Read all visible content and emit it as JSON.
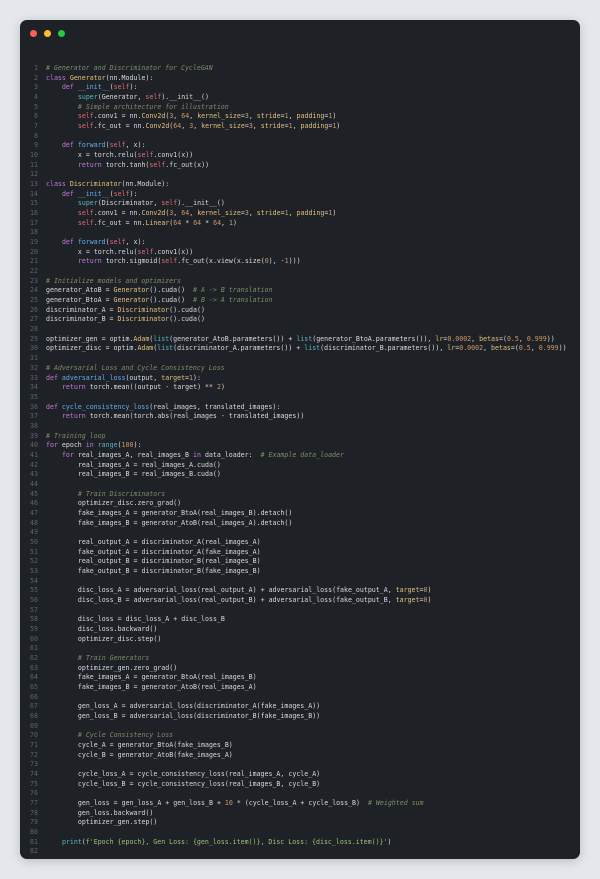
{
  "window": {
    "controls": [
      "close",
      "minimize",
      "maximize"
    ],
    "colors": {
      "close": "#ff5f57",
      "minimize": "#febc2e",
      "maximize": "#28c840",
      "background": "#1e2126"
    }
  },
  "editor": {
    "language": "python",
    "lines": [
      "# Generator and Discriminator for CycleGAN",
      "class Generator(nn.Module):",
      "    def __init__(self):",
      "        super(Generator, self).__init__()",
      "        # Simple architecture for illustration",
      "        self.conv1 = nn.Conv2d(3, 64, kernel_size=3, stride=1, padding=1)",
      "        self.fc_out = nn.Conv2d(64, 3, kernel_size=3, stride=1, padding=1)",
      "",
      "    def forward(self, x):",
      "        x = torch.relu(self.conv1(x))",
      "        return torch.tanh(self.fc_out(x))",
      "",
      "class Discriminator(nn.Module):",
      "    def __init__(self):",
      "        super(Discriminator, self).__init__()",
      "        self.conv1 = nn.Conv2d(3, 64, kernel_size=3, stride=1, padding=1)",
      "        self.fc_out = nn.Linear(64 * 64 * 64, 1)",
      "",
      "    def forward(self, x):",
      "        x = torch.relu(self.conv1(x))",
      "        return torch.sigmoid(self.fc_out(x.view(x.size(0), -1)))",
      "",
      "# Initialize models and optimizers",
      "generator_AtoB = Generator().cuda()  # A -> B translation",
      "generator_BtoA = Generator().cuda()  # B -> A translation",
      "discriminator_A = Discriminator().cuda()",
      "discriminator_B = Discriminator().cuda()",
      "",
      "optimizer_gen = optim.Adam(list(generator_AtoB.parameters()) + list(generator_BtoA.parameters()), lr=0.0002, betas=(0.5, 0.999))",
      "optimizer_disc = optim.Adam(list(discriminator_A.parameters()) + list(discriminator_B.parameters()), lr=0.0002, betas=(0.5, 0.999))",
      "",
      "# Adversarial Loss and Cycle Consistency Loss",
      "def adversarial_loss(output, target=1):",
      "    return torch.mean((output - target) ** 2)",
      "",
      "def cycle_consistency_loss(real_images, translated_images):",
      "    return torch.mean(torch.abs(real_images - translated_images))",
      "",
      "# Training loop",
      "for epoch in range(100):",
      "    for real_images_A, real_images_B in data_loader:  # Example data_loader",
      "        real_images_A = real_images_A.cuda()",
      "        real_images_B = real_images_B.cuda()",
      "",
      "        # Train Discriminators",
      "        optimizer_disc.zero_grad()",
      "        fake_images_A = generator_BtoA(real_images_B).detach()",
      "        fake_images_B = generator_AtoB(real_images_A).detach()",
      "",
      "        real_output_A = discriminator_A(real_images_A)",
      "        fake_output_A = discriminator_A(fake_images_A)",
      "        real_output_B = discriminator_B(real_images_B)",
      "        fake_output_B = discriminator_B(fake_images_B)",
      "",
      "        disc_loss_A = adversarial_loss(real_output_A) + adversarial_loss(fake_output_A, target=0)",
      "        disc_loss_B = adversarial_loss(real_output_B) + adversarial_loss(fake_output_B, target=0)",
      "",
      "        disc_loss = disc_loss_A + disc_loss_B",
      "        disc_loss.backward()",
      "        optimizer_disc.step()",
      "",
      "        # Train Generators",
      "        optimizer_gen.zero_grad()",
      "        fake_images_A = generator_BtoA(real_images_B)",
      "        fake_images_B = generator_AtoB(real_images_A)",
      "",
      "        gen_loss_A = adversarial_loss(discriminator_A(fake_images_A))",
      "        gen_loss_B = adversarial_loss(discriminator_B(fake_images_B))",
      "",
      "        # Cycle Consistency Loss",
      "        cycle_A = generator_BtoA(fake_images_B)",
      "        cycle_B = generator_AtoB(fake_images_A)",
      "",
      "        cycle_loss_A = cycle_consistency_loss(real_images_A, cycle_A)",
      "        cycle_loss_B = cycle_consistency_loss(real_images_B, cycle_B)",
      "",
      "        gen_loss = gen_loss_A + gen_loss_B + 10 * (cycle_loss_A + cycle_loss_B)  # Weighted sum",
      "        gen_loss.backward()",
      "        optimizer_gen.step()",
      "",
      "    print(f'Epoch {epoch}, Gen Loss: {gen_loss.item()}, Disc Loss: {disc_loss.item()}')",
      ""
    ]
  }
}
